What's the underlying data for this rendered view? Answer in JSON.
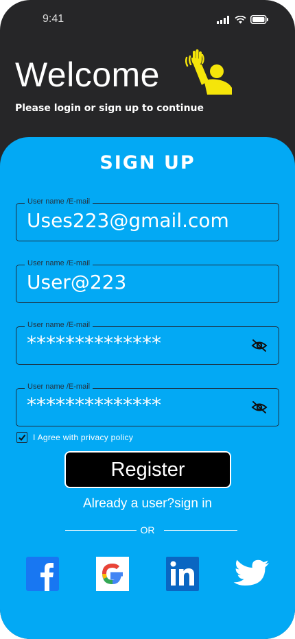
{
  "status_bar": {
    "time": "9:41"
  },
  "header": {
    "welcome": "Welcome",
    "subtitle": "Please login or sign up to continue"
  },
  "form": {
    "title": "SIGN UP",
    "fields": [
      {
        "label": "User name /E-mail",
        "value": "Uses223@gmail.com"
      },
      {
        "label": "User name /E-mail",
        "value": "User@223"
      },
      {
        "label": "User name /E-mail",
        "value": "**************"
      },
      {
        "label": "User name /E-mail",
        "value": "**************"
      }
    ],
    "agree_text": "I Agree with privacy policy",
    "register_label": "Register",
    "signin_text": "Already a user?sign in",
    "or_text": "OR"
  },
  "social": [
    "facebook-icon",
    "google-icon",
    "linkedin-icon",
    "twitter-icon"
  ],
  "colors": {
    "dark_bg": "#262628",
    "card_bg": "#03a9f4",
    "accent_yellow": "#f5e50a"
  }
}
